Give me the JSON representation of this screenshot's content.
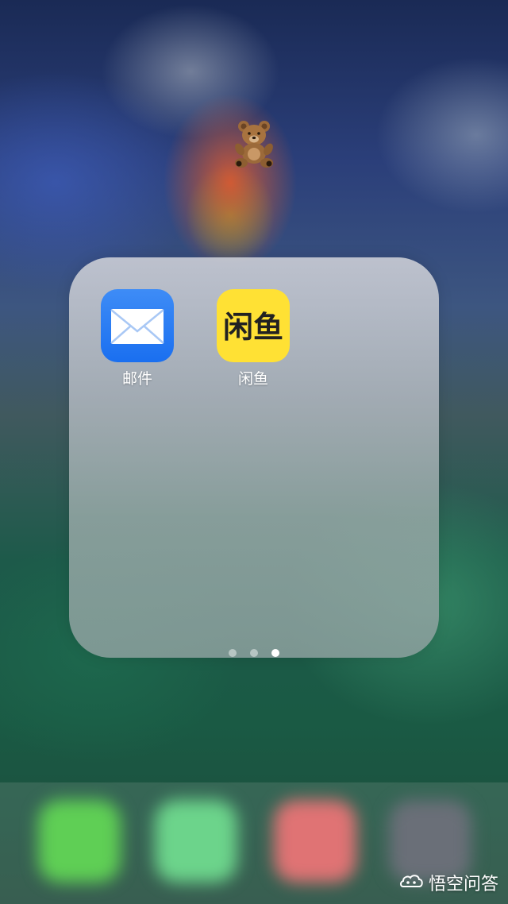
{
  "folder": {
    "apps": [
      {
        "label": "邮件",
        "icon": "mail-icon",
        "accent": "#1a6ff0"
      },
      {
        "label": "闲鱼",
        "icon": "xianyu-icon",
        "accent": "#ffe134",
        "icon_text": "闲鱼"
      }
    ],
    "page_indicator": {
      "pages": 3,
      "current": 3
    }
  },
  "decorations": {
    "sticker": "teddy-bear-emoji"
  },
  "dock": {
    "apps": [
      {
        "icon": "phone-icon",
        "color": "#5fcf55"
      },
      {
        "icon": "messages-icon",
        "color": "#6cd48b"
      },
      {
        "icon": "music-icon",
        "color": "#e07374"
      },
      {
        "icon": "camera-icon",
        "color": "#6a6f78"
      }
    ]
  },
  "watermark": {
    "text": "悟空问答"
  }
}
